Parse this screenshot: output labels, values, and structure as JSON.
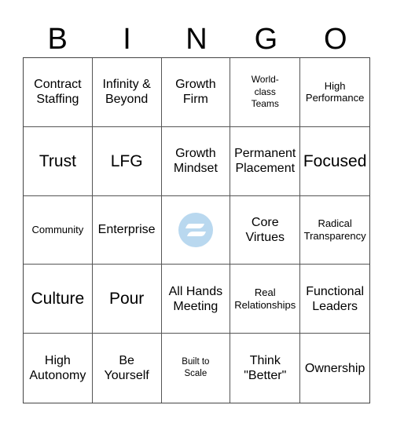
{
  "header": {
    "letters": [
      "B",
      "I",
      "N",
      "G",
      "O"
    ]
  },
  "card": {
    "free_space": {
      "icon": "brand-logo-icon",
      "color": "#b9d8ef"
    },
    "rows": [
      [
        "Contract Staffing",
        "Infinity & Beyond",
        "Growth Firm",
        "World-class Teams",
        "High Performance"
      ],
      [
        "Trust",
        "LFG",
        "Growth Mindset",
        "Permanent Placement",
        "Focused"
      ],
      [
        "Community",
        "Enterprise",
        "",
        "Core Virtues",
        "Radical Transparency"
      ],
      [
        "Culture",
        "Pour",
        "All Hands Meeting",
        "Real Relationships",
        "Functional Leaders"
      ],
      [
        "High Autonomy",
        "Be Yourself",
        "Built to Scale",
        "Think \"Better\"",
        "Ownership"
      ]
    ]
  }
}
